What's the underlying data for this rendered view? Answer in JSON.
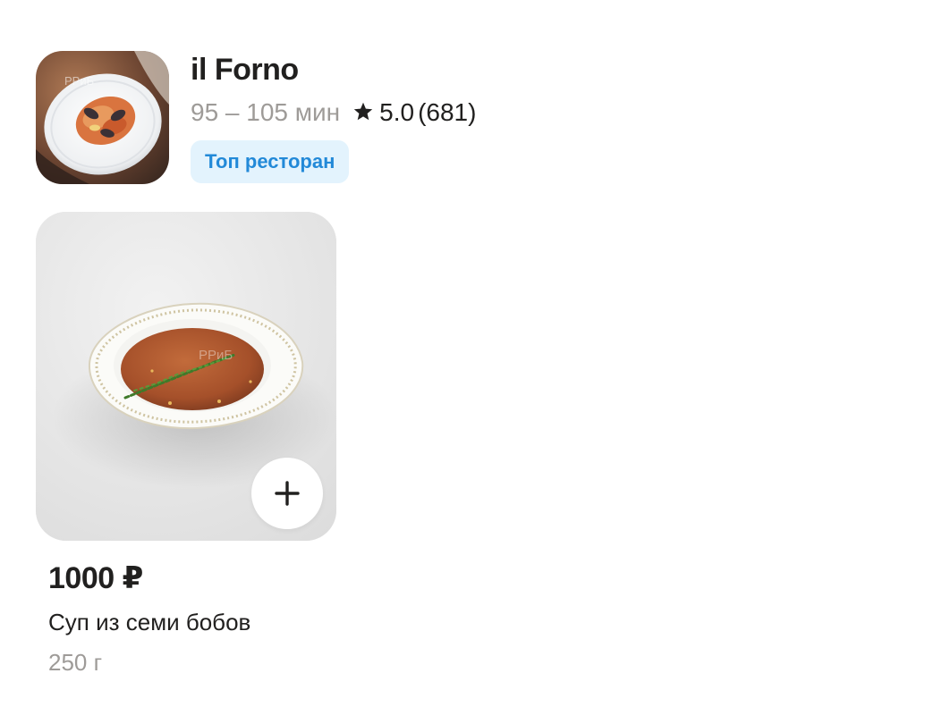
{
  "restaurant": {
    "name": "il Forno",
    "delivery_time": "95 – 105 мин",
    "rating": "5.0",
    "reviews": "(681)",
    "badge": "Топ ресторан",
    "thumbnail": "pasta-dish-image",
    "star_icon": "star-icon"
  },
  "product": {
    "price": "1000 ₽",
    "name": "Суп из семи бобов",
    "weight": "250 г",
    "image": "soup-bowl-image",
    "add_icon": "plus-icon"
  },
  "colors": {
    "text_primary": "#21201f",
    "text_secondary": "#9e9b98",
    "badge_bg": "#e3f3fd",
    "badge_text": "#2289d8",
    "card_bg": "#e6e6e6"
  }
}
